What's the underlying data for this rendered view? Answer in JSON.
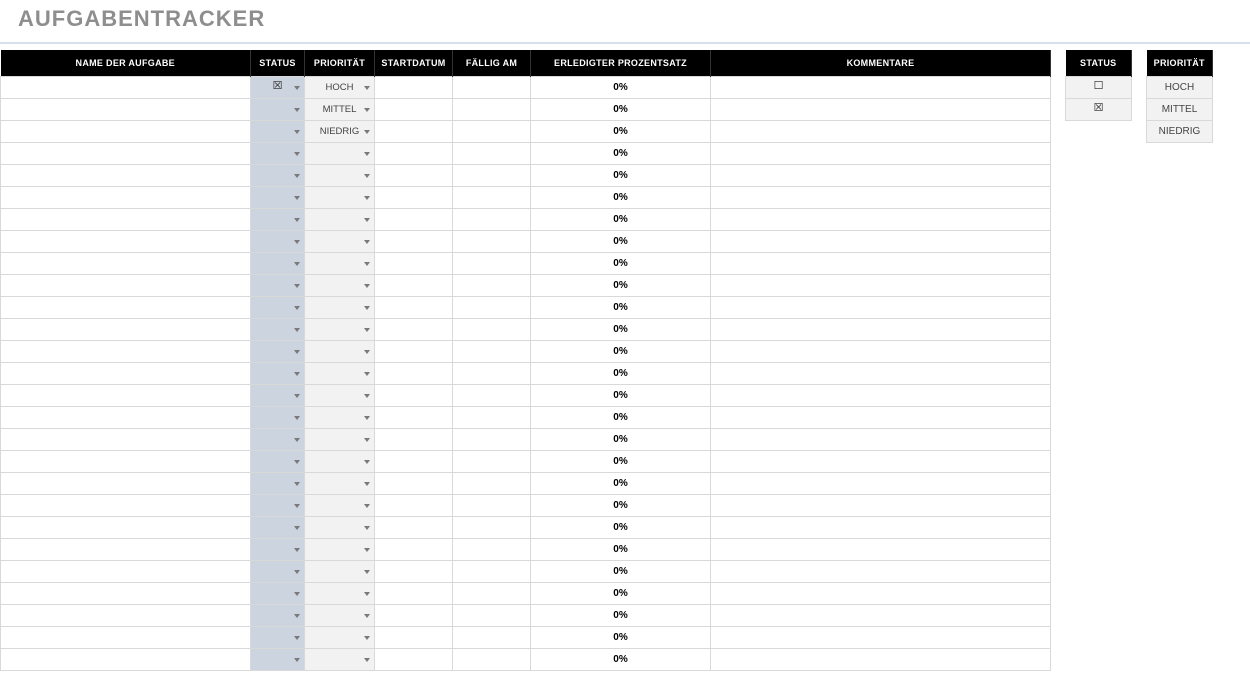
{
  "title": "AUFGABENTRACKER",
  "columns": {
    "name": "NAME DER AUFGABE",
    "status": "STATUS",
    "priority": "PRIORITÄT",
    "start": "STARTDATUM",
    "due": "FÄLLIG AM",
    "pct": "ERLEDIGTER PROZENTSATZ",
    "comments": "KOMMENTARE"
  },
  "legend_status": {
    "header": "STATUS",
    "unchecked": "☐",
    "checked": "☒"
  },
  "legend_priority": {
    "header": "PRIORITÄT",
    "options": [
      "HOCH",
      "MITTEL",
      "NIEDRIG"
    ]
  },
  "rows": [
    {
      "name": "",
      "status": "☒",
      "priority": "HOCH",
      "start": "",
      "due": "",
      "pct": "0%",
      "comment": ""
    },
    {
      "name": "",
      "status": "",
      "priority": "MITTEL",
      "start": "",
      "due": "",
      "pct": "0%",
      "comment": ""
    },
    {
      "name": "",
      "status": "",
      "priority": "NIEDRIG",
      "start": "",
      "due": "",
      "pct": "0%",
      "comment": ""
    },
    {
      "name": "",
      "status": "",
      "priority": "",
      "start": "",
      "due": "",
      "pct": "0%",
      "comment": ""
    },
    {
      "name": "",
      "status": "",
      "priority": "",
      "start": "",
      "due": "",
      "pct": "0%",
      "comment": ""
    },
    {
      "name": "",
      "status": "",
      "priority": "",
      "start": "",
      "due": "",
      "pct": "0%",
      "comment": ""
    },
    {
      "name": "",
      "status": "",
      "priority": "",
      "start": "",
      "due": "",
      "pct": "0%",
      "comment": ""
    },
    {
      "name": "",
      "status": "",
      "priority": "",
      "start": "",
      "due": "",
      "pct": "0%",
      "comment": ""
    },
    {
      "name": "",
      "status": "",
      "priority": "",
      "start": "",
      "due": "",
      "pct": "0%",
      "comment": ""
    },
    {
      "name": "",
      "status": "",
      "priority": "",
      "start": "",
      "due": "",
      "pct": "0%",
      "comment": ""
    },
    {
      "name": "",
      "status": "",
      "priority": "",
      "start": "",
      "due": "",
      "pct": "0%",
      "comment": ""
    },
    {
      "name": "",
      "status": "",
      "priority": "",
      "start": "",
      "due": "",
      "pct": "0%",
      "comment": ""
    },
    {
      "name": "",
      "status": "",
      "priority": "",
      "start": "",
      "due": "",
      "pct": "0%",
      "comment": ""
    },
    {
      "name": "",
      "status": "",
      "priority": "",
      "start": "",
      "due": "",
      "pct": "0%",
      "comment": ""
    },
    {
      "name": "",
      "status": "",
      "priority": "",
      "start": "",
      "due": "",
      "pct": "0%",
      "comment": ""
    },
    {
      "name": "",
      "status": "",
      "priority": "",
      "start": "",
      "due": "",
      "pct": "0%",
      "comment": ""
    },
    {
      "name": "",
      "status": "",
      "priority": "",
      "start": "",
      "due": "",
      "pct": "0%",
      "comment": ""
    },
    {
      "name": "",
      "status": "",
      "priority": "",
      "start": "",
      "due": "",
      "pct": "0%",
      "comment": ""
    },
    {
      "name": "",
      "status": "",
      "priority": "",
      "start": "",
      "due": "",
      "pct": "0%",
      "comment": ""
    },
    {
      "name": "",
      "status": "",
      "priority": "",
      "start": "",
      "due": "",
      "pct": "0%",
      "comment": ""
    },
    {
      "name": "",
      "status": "",
      "priority": "",
      "start": "",
      "due": "",
      "pct": "0%",
      "comment": ""
    },
    {
      "name": "",
      "status": "",
      "priority": "",
      "start": "",
      "due": "",
      "pct": "0%",
      "comment": ""
    },
    {
      "name": "",
      "status": "",
      "priority": "",
      "start": "",
      "due": "",
      "pct": "0%",
      "comment": ""
    },
    {
      "name": "",
      "status": "",
      "priority": "",
      "start": "",
      "due": "",
      "pct": "0%",
      "comment": ""
    },
    {
      "name": "",
      "status": "",
      "priority": "",
      "start": "",
      "due": "",
      "pct": "0%",
      "comment": ""
    },
    {
      "name": "",
      "status": "",
      "priority": "",
      "start": "",
      "due": "",
      "pct": "0%",
      "comment": ""
    },
    {
      "name": "",
      "status": "",
      "priority": "",
      "start": "",
      "due": "",
      "pct": "0%",
      "comment": ""
    }
  ]
}
